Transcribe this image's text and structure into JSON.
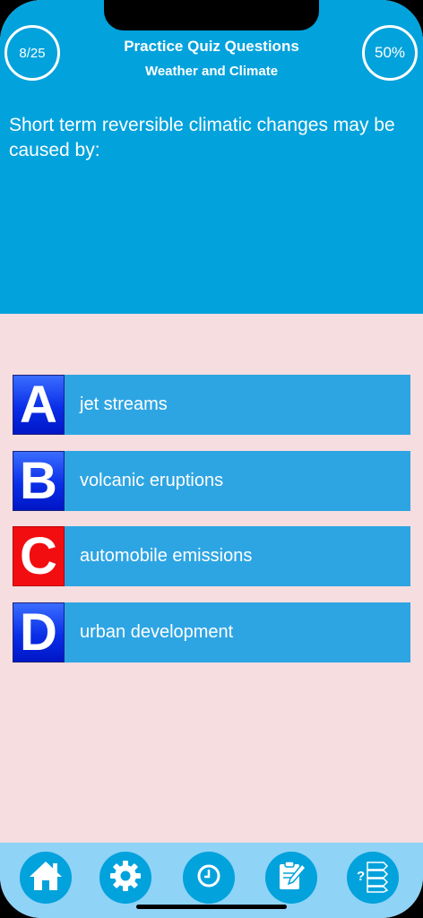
{
  "header": {
    "progress_counter": "8/25",
    "score_percent": "50%",
    "title": "Practice Quiz Questions",
    "subtitle": "Weather and Climate"
  },
  "question": {
    "text": "Short term reversible climatic changes may be caused by:"
  },
  "answers": [
    {
      "letter": "A",
      "text": "jet streams",
      "state": "default"
    },
    {
      "letter": "B",
      "text": "volcanic eruptions",
      "state": "default"
    },
    {
      "letter": "C",
      "text": "automobile emissions",
      "state": "incorrect"
    },
    {
      "letter": "D",
      "text": "urban development",
      "state": "default"
    }
  ],
  "tabbar": {
    "items": [
      {
        "icon": "home-icon"
      },
      {
        "icon": "gear-icon"
      },
      {
        "icon": "clock-icon"
      },
      {
        "icon": "notepad-edit-icon"
      },
      {
        "icon": "question-list-icon"
      }
    ]
  },
  "colors": {
    "header_bg": "#02a2dc",
    "body_bg": "#f6dde0",
    "answer_bg": "#2ea5e3",
    "letter_blue": "#0a2ee8",
    "letter_red": "#f20d10",
    "tabbar_bg": "#8fd3f7"
  }
}
